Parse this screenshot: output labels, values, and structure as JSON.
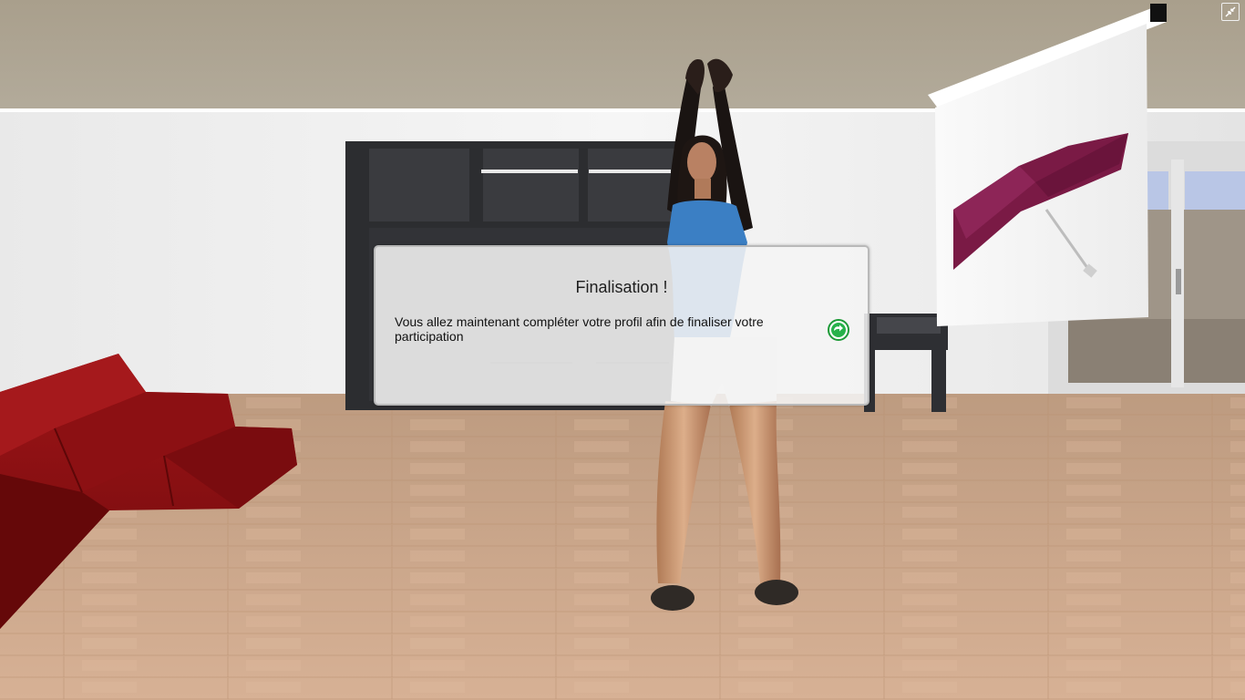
{
  "dialog": {
    "title": "Finalisation !",
    "message": "Vous allez maintenant compléter votre profil afin de finaliser votre participation",
    "next_icon": "green-arrow-circle-icon"
  },
  "toolbar": {
    "fullscreen_icon": "exit-fullscreen-icon"
  },
  "scene": {
    "description_icons": [
      "avatar",
      "red-sofa",
      "dark-bookshelf",
      "projector-screen",
      "umbrella-product-image",
      "desk",
      "window"
    ],
    "colors": {
      "ceiling": "#a89f8d",
      "wall": "#f1f1f1",
      "floor": "#caa384",
      "sofa": "#8e0f12",
      "shelf": "#2c2d30",
      "shirt": "#3b7fc4",
      "umbrella": "#7a1a45"
    }
  }
}
